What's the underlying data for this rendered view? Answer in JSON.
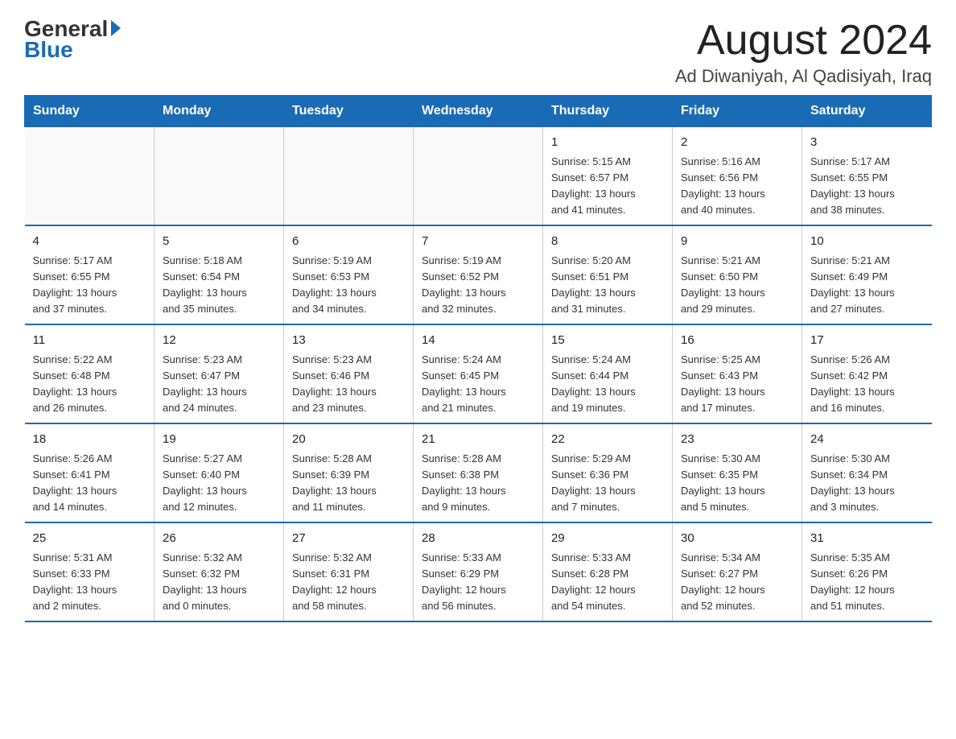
{
  "logo": {
    "general": "General",
    "blue": "Blue"
  },
  "header": {
    "month_year": "August 2024",
    "location": "Ad Diwaniyah, Al Qadisiyah, Iraq"
  },
  "days_of_week": [
    "Sunday",
    "Monday",
    "Tuesday",
    "Wednesday",
    "Thursday",
    "Friday",
    "Saturday"
  ],
  "weeks": [
    [
      {
        "day": "",
        "info": ""
      },
      {
        "day": "",
        "info": ""
      },
      {
        "day": "",
        "info": ""
      },
      {
        "day": "",
        "info": ""
      },
      {
        "day": "1",
        "info": "Sunrise: 5:15 AM\nSunset: 6:57 PM\nDaylight: 13 hours\nand 41 minutes."
      },
      {
        "day": "2",
        "info": "Sunrise: 5:16 AM\nSunset: 6:56 PM\nDaylight: 13 hours\nand 40 minutes."
      },
      {
        "day": "3",
        "info": "Sunrise: 5:17 AM\nSunset: 6:55 PM\nDaylight: 13 hours\nand 38 minutes."
      }
    ],
    [
      {
        "day": "4",
        "info": "Sunrise: 5:17 AM\nSunset: 6:55 PM\nDaylight: 13 hours\nand 37 minutes."
      },
      {
        "day": "5",
        "info": "Sunrise: 5:18 AM\nSunset: 6:54 PM\nDaylight: 13 hours\nand 35 minutes."
      },
      {
        "day": "6",
        "info": "Sunrise: 5:19 AM\nSunset: 6:53 PM\nDaylight: 13 hours\nand 34 minutes."
      },
      {
        "day": "7",
        "info": "Sunrise: 5:19 AM\nSunset: 6:52 PM\nDaylight: 13 hours\nand 32 minutes."
      },
      {
        "day": "8",
        "info": "Sunrise: 5:20 AM\nSunset: 6:51 PM\nDaylight: 13 hours\nand 31 minutes."
      },
      {
        "day": "9",
        "info": "Sunrise: 5:21 AM\nSunset: 6:50 PM\nDaylight: 13 hours\nand 29 minutes."
      },
      {
        "day": "10",
        "info": "Sunrise: 5:21 AM\nSunset: 6:49 PM\nDaylight: 13 hours\nand 27 minutes."
      }
    ],
    [
      {
        "day": "11",
        "info": "Sunrise: 5:22 AM\nSunset: 6:48 PM\nDaylight: 13 hours\nand 26 minutes."
      },
      {
        "day": "12",
        "info": "Sunrise: 5:23 AM\nSunset: 6:47 PM\nDaylight: 13 hours\nand 24 minutes."
      },
      {
        "day": "13",
        "info": "Sunrise: 5:23 AM\nSunset: 6:46 PM\nDaylight: 13 hours\nand 23 minutes."
      },
      {
        "day": "14",
        "info": "Sunrise: 5:24 AM\nSunset: 6:45 PM\nDaylight: 13 hours\nand 21 minutes."
      },
      {
        "day": "15",
        "info": "Sunrise: 5:24 AM\nSunset: 6:44 PM\nDaylight: 13 hours\nand 19 minutes."
      },
      {
        "day": "16",
        "info": "Sunrise: 5:25 AM\nSunset: 6:43 PM\nDaylight: 13 hours\nand 17 minutes."
      },
      {
        "day": "17",
        "info": "Sunrise: 5:26 AM\nSunset: 6:42 PM\nDaylight: 13 hours\nand 16 minutes."
      }
    ],
    [
      {
        "day": "18",
        "info": "Sunrise: 5:26 AM\nSunset: 6:41 PM\nDaylight: 13 hours\nand 14 minutes."
      },
      {
        "day": "19",
        "info": "Sunrise: 5:27 AM\nSunset: 6:40 PM\nDaylight: 13 hours\nand 12 minutes."
      },
      {
        "day": "20",
        "info": "Sunrise: 5:28 AM\nSunset: 6:39 PM\nDaylight: 13 hours\nand 11 minutes."
      },
      {
        "day": "21",
        "info": "Sunrise: 5:28 AM\nSunset: 6:38 PM\nDaylight: 13 hours\nand 9 minutes."
      },
      {
        "day": "22",
        "info": "Sunrise: 5:29 AM\nSunset: 6:36 PM\nDaylight: 13 hours\nand 7 minutes."
      },
      {
        "day": "23",
        "info": "Sunrise: 5:30 AM\nSunset: 6:35 PM\nDaylight: 13 hours\nand 5 minutes."
      },
      {
        "day": "24",
        "info": "Sunrise: 5:30 AM\nSunset: 6:34 PM\nDaylight: 13 hours\nand 3 minutes."
      }
    ],
    [
      {
        "day": "25",
        "info": "Sunrise: 5:31 AM\nSunset: 6:33 PM\nDaylight: 13 hours\nand 2 minutes."
      },
      {
        "day": "26",
        "info": "Sunrise: 5:32 AM\nSunset: 6:32 PM\nDaylight: 13 hours\nand 0 minutes."
      },
      {
        "day": "27",
        "info": "Sunrise: 5:32 AM\nSunset: 6:31 PM\nDaylight: 12 hours\nand 58 minutes."
      },
      {
        "day": "28",
        "info": "Sunrise: 5:33 AM\nSunset: 6:29 PM\nDaylight: 12 hours\nand 56 minutes."
      },
      {
        "day": "29",
        "info": "Sunrise: 5:33 AM\nSunset: 6:28 PM\nDaylight: 12 hours\nand 54 minutes."
      },
      {
        "day": "30",
        "info": "Sunrise: 5:34 AM\nSunset: 6:27 PM\nDaylight: 12 hours\nand 52 minutes."
      },
      {
        "day": "31",
        "info": "Sunrise: 5:35 AM\nSunset: 6:26 PM\nDaylight: 12 hours\nand 51 minutes."
      }
    ]
  ]
}
